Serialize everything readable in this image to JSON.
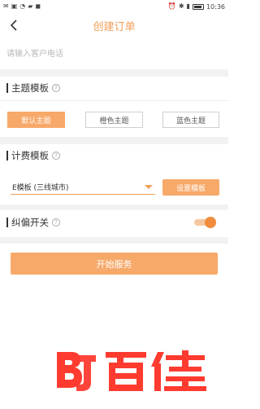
{
  "status_bar": {
    "time": "10:36"
  },
  "header": {
    "title": "创建订单"
  },
  "phone": {
    "placeholder": "请输入客户电话"
  },
  "theme_section": {
    "title": "主题模板",
    "options": [
      "默认主题",
      "橙色主题",
      "蓝色主题"
    ],
    "selected_index": 0
  },
  "billing_section": {
    "title": "计费模板",
    "selected_template": "E模板 (三线城市)",
    "set_button": "设置模板"
  },
  "correction_section": {
    "title": "纠偏开关",
    "enabled": true
  },
  "start_button": "开始服务",
  "watermark": {
    "logo_text": "BJ",
    "text": "百佳"
  },
  "colors": {
    "accent": "#f7a96a",
    "title": "#f2a05a"
  }
}
